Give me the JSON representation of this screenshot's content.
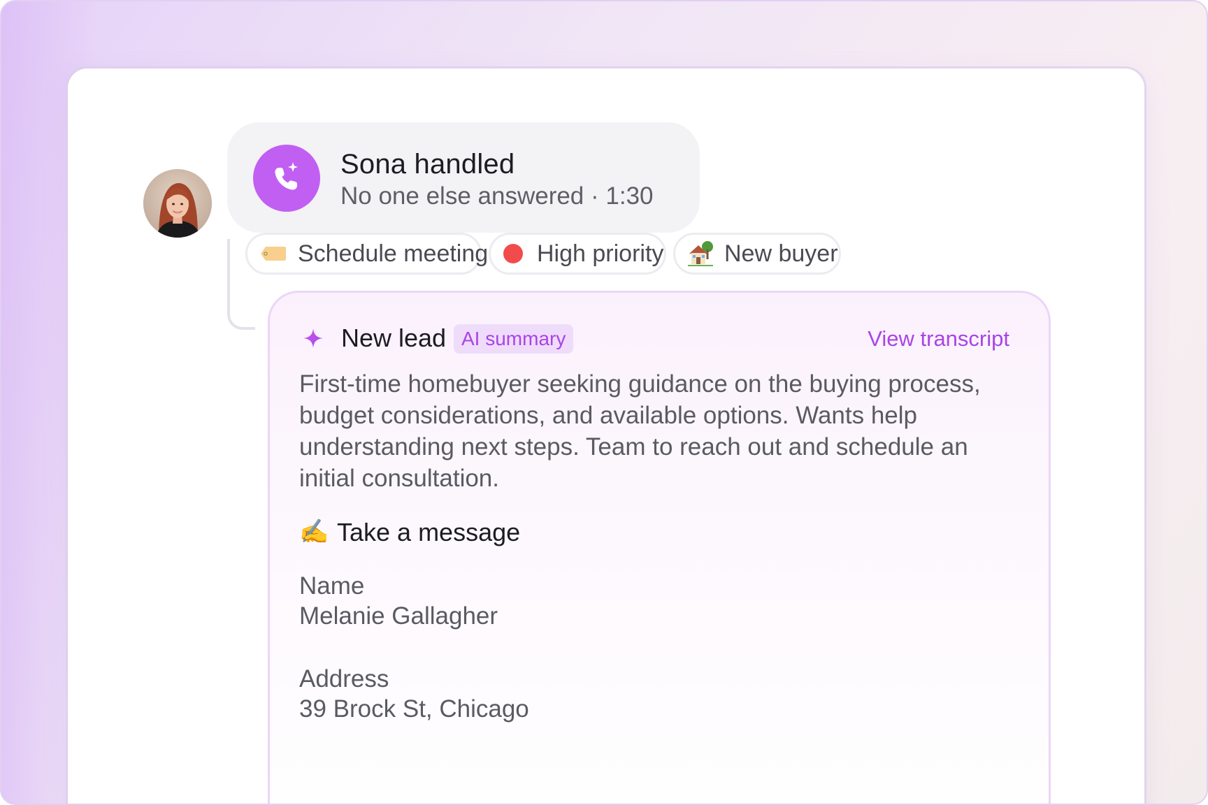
{
  "handled": {
    "title": "Sona handled",
    "subtitle": "No one else answered · 1:30",
    "icon": "phone-sparkle-icon",
    "accent_color": "#c15ff2"
  },
  "tags": [
    {
      "label": "Schedule meeting",
      "icon": "tag-icon"
    },
    {
      "label": "High priority",
      "icon": "red-dot-icon",
      "color": "#f24b4b"
    },
    {
      "label": "New buyer",
      "icon": "house-icon"
    }
  ],
  "summary": {
    "title": "New lead",
    "badge": "AI summary",
    "link": "View transcript",
    "text": "First-time homebuyer seeking guidance on the buying process, budget considerations, and available options. Wants help understanding next steps. Team to reach out and schedule an initial consultation.",
    "accent_color": "#a944e6"
  },
  "message": {
    "icon": "✍️",
    "title": "Take a message",
    "fields": [
      {
        "label": "Name",
        "value": "Melanie Gallagher"
      },
      {
        "label": "Address",
        "value": "39 Brock St, Chicago"
      }
    ]
  }
}
